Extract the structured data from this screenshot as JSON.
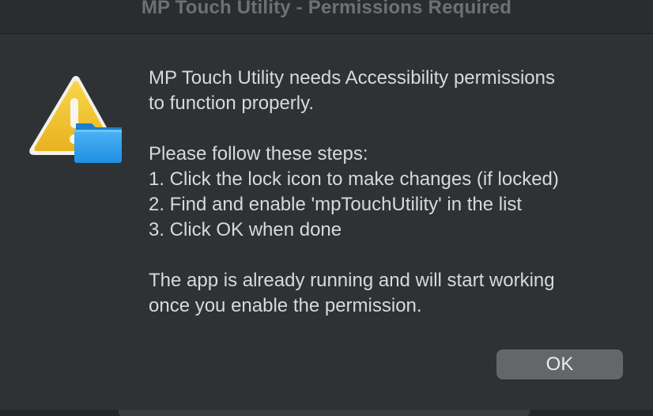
{
  "window": {
    "title": "MP Touch Utility - Permissions Required"
  },
  "icon": {
    "name": "warning-folder-icon",
    "colors": {
      "triangle": "#f2c230",
      "folder": "#2c9ef0"
    }
  },
  "message": {
    "line1": "MP Touch Utility needs Accessibility permissions",
    "line2": "to function properly.",
    "steps_heading": "Please follow these steps:",
    "step1": "1. Click the lock icon to make changes (if locked)",
    "step2": "2. Find and enable 'mpTouchUtility' in the list",
    "step3": "3. Click OK when done",
    "footer1": "The app is already running and will start working",
    "footer2": "once you enable the permission."
  },
  "buttons": {
    "ok_label": "OK"
  }
}
